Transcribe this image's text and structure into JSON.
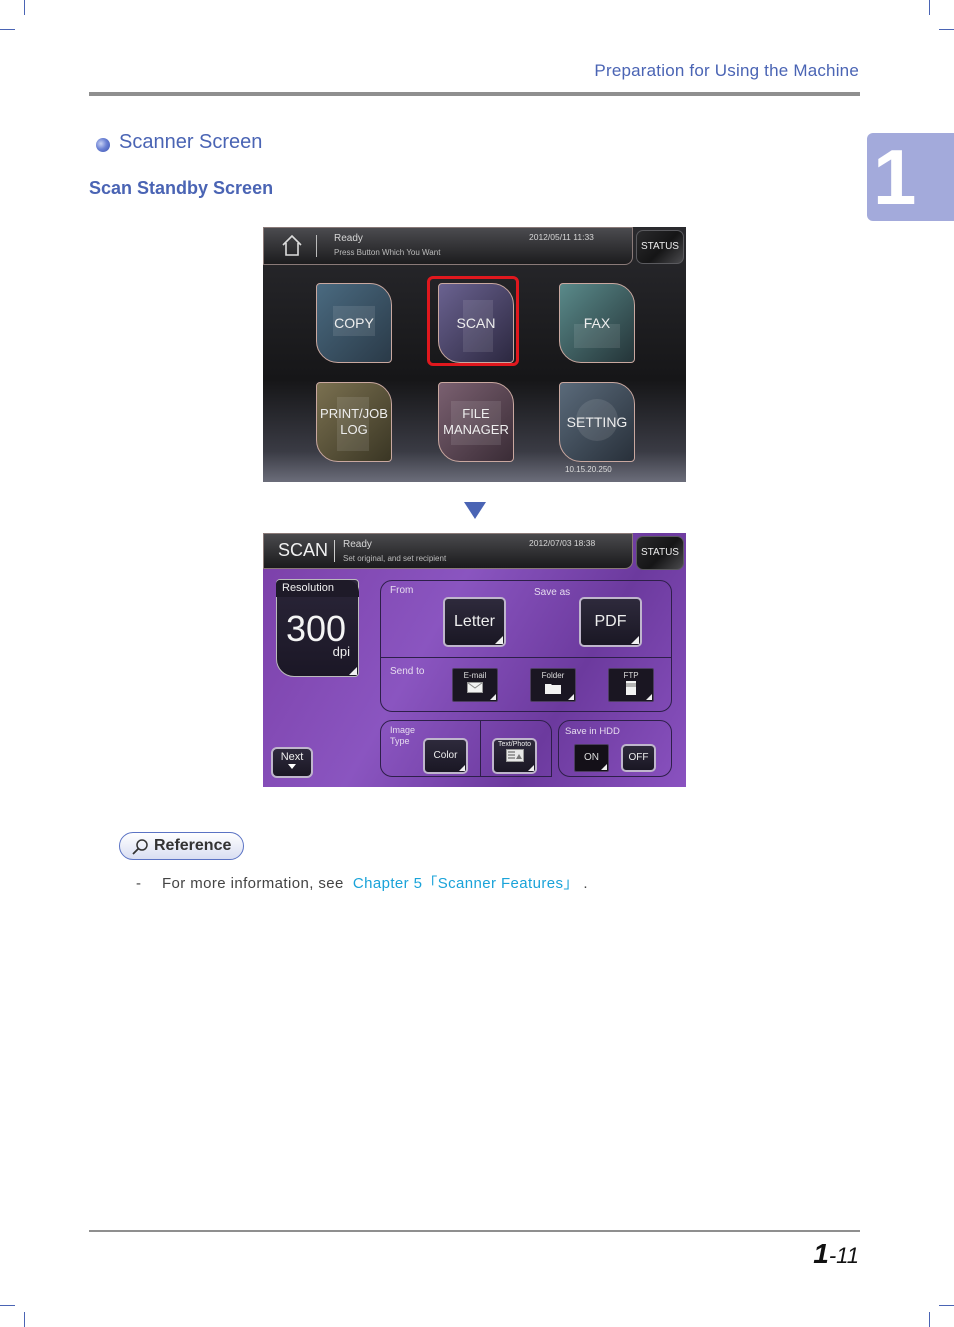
{
  "header": {
    "title": "Preparation for Using the Machine"
  },
  "chapter_tab": {
    "number": "1"
  },
  "section": {
    "title": "Scanner Screen",
    "subtitle": "Scan Standby Screen"
  },
  "screen_home": {
    "status": "Ready",
    "message": "Press Button Which You Want",
    "datetime": "2012/05/11 11:33",
    "status_button": "STATUS",
    "tiles": [
      {
        "label": "COPY",
        "color": "#3c5466"
      },
      {
        "label": "SCAN",
        "color": "#3e3a5a",
        "selected": true
      },
      {
        "label": "FAX",
        "color": "#365460"
      },
      {
        "label": "PRINT/JOB LOG",
        "color": "#5a543c"
      },
      {
        "label": "FILE MANAGER",
        "color": "#5a4654"
      },
      {
        "label": "SETTING",
        "color": "#3c4a58"
      }
    ],
    "ip_address": "10.15.20.250",
    "highlight_color": "#e0181e"
  },
  "screen_scan": {
    "mode": "SCAN",
    "status": "Ready",
    "message": "Set original, and set recipient",
    "datetime": "2012/07/03 18:38",
    "status_button": "STATUS",
    "resolution": {
      "label": "Resolution",
      "value": "300",
      "unit": "dpi"
    },
    "from": {
      "label": "From",
      "value": "Letter"
    },
    "save_as": {
      "label": "Save as",
      "value": "PDF"
    },
    "send_to": {
      "label": "Send to",
      "options": [
        "E-mail",
        "Folder",
        "FTP"
      ]
    },
    "image_type": {
      "label_line1": "Image",
      "label_line2": "Type",
      "color_button": "Color",
      "mode_button": "Text/Photo"
    },
    "save_in_hdd": {
      "label": "Save in HDD",
      "on": "ON",
      "off": "OFF"
    },
    "next_button": "Next"
  },
  "reference": {
    "badge": "Reference",
    "dash": "-",
    "text": "For more information, see",
    "link": "Chapter 5「Scanner Features」",
    "end": "."
  },
  "footer": {
    "chapter": "1",
    "page": "-11"
  },
  "colors": {
    "accent": "#4a64b4",
    "link": "#1aa3d9",
    "chapter_tab": "#a3aadb"
  }
}
